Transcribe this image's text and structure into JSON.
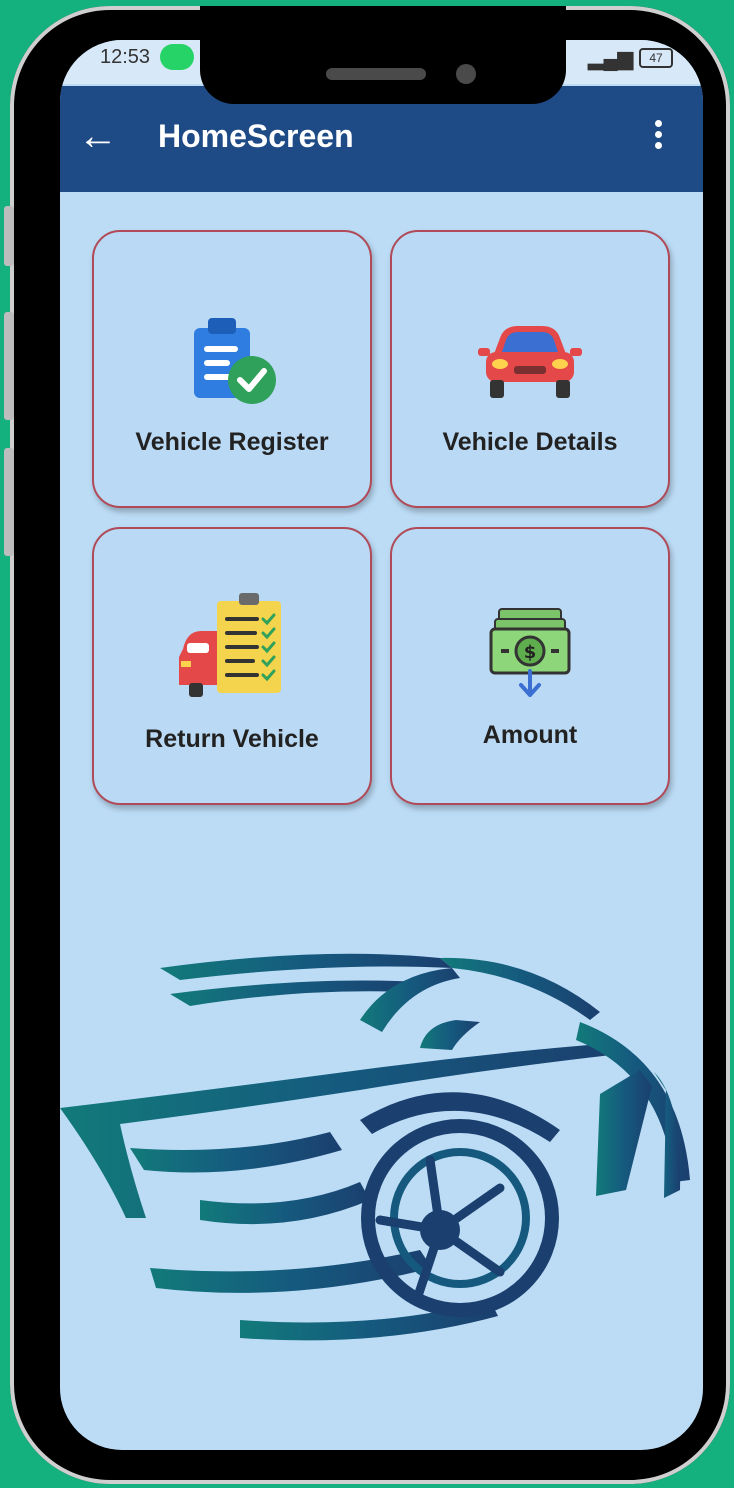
{
  "status_bar": {
    "time": "12:53",
    "battery": "47"
  },
  "app_bar": {
    "title": "HomeScreen",
    "back_icon": "arrow-left-icon",
    "menu_icon": "more-vert-icon"
  },
  "tiles": [
    {
      "label": "Vehicle Register",
      "icon": "clipboard-check-icon"
    },
    {
      "label": "Vehicle Details",
      "icon": "car-icon"
    },
    {
      "label": "Return Vehicle",
      "icon": "car-checklist-icon"
    },
    {
      "label": "Amount",
      "icon": "money-icon"
    }
  ],
  "colors": {
    "appbar": "#1e4a86",
    "screen_bg": "#bcdcf6",
    "card_border": "#b04a58",
    "frame_bg": "#14b07e"
  }
}
